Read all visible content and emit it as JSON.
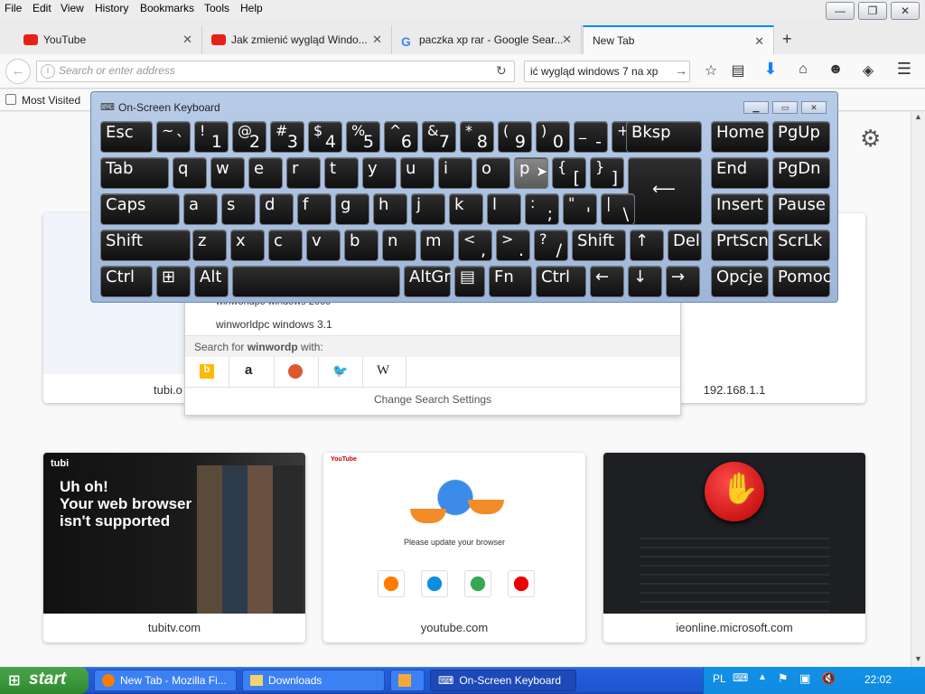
{
  "menubar": {
    "items": [
      "File",
      "Edit",
      "View",
      "History",
      "Bookmarks",
      "Tools",
      "Help"
    ]
  },
  "window_controls": {
    "minimize": "—",
    "maximize": "❐",
    "close": "✕"
  },
  "tabs": [
    {
      "label": "YouTube",
      "icon": "youtube-icon"
    },
    {
      "label": "Jak zmienić wygląd Windo...",
      "icon": "youtube-icon"
    },
    {
      "label": "paczka xp rar - Google Sear...",
      "icon": "google-icon"
    },
    {
      "label": "New Tab",
      "icon": "",
      "active": true
    }
  ],
  "navbar": {
    "url_placeholder": "Search or enter address",
    "search_value": "ić wygląd windows 7 na xp"
  },
  "bookmarks": {
    "most_visited": "Most Visited"
  },
  "dropdown": {
    "suggestions": [
      "winworldpc windows 2000",
      "winworldpc windows 3.1"
    ],
    "search_for_prefix": "Search for ",
    "search_for_term": "winwordp",
    "search_for_suffix": " with:",
    "engines": [
      "bing",
      "amazon",
      "duckduckgo",
      "twitter",
      "wikipedia"
    ],
    "wiki_label": "W",
    "change_settings": "Change Search Settings"
  },
  "top_sites_row1": {
    "left_label": "tubi.o",
    "right_label": "192.168.1.1"
  },
  "top_sites": [
    {
      "label": "tubitv.com",
      "headline": "Uh oh!\nYour web browser\nisn't supported",
      "brand": "tubi"
    },
    {
      "label": "youtube.com",
      "headline": "Please update your browser",
      "brand": "YouTube",
      "browsers": [
        "Mozilla Firefox",
        "Microsoft Edge",
        "Google Chrome",
        "Opera"
      ]
    },
    {
      "label": "ieonline.microsoft.com"
    }
  ],
  "osk": {
    "title": "On-Screen Keyboard",
    "rows": [
      [
        {
          "m": "Esc"
        },
        {
          "t": "~",
          "b": "`"
        },
        {
          "t": "!",
          "b": "1"
        },
        {
          "t": "@",
          "b": "2"
        },
        {
          "t": "#",
          "b": "3"
        },
        {
          "t": "$",
          "b": "4"
        },
        {
          "t": "%",
          "b": "5"
        },
        {
          "t": "^",
          "b": "6"
        },
        {
          "t": "&",
          "b": "7"
        },
        {
          "t": "*",
          "b": "8"
        },
        {
          "t": "(",
          "b": "9"
        },
        {
          "t": ")",
          "b": "0"
        },
        {
          "t": "_",
          "b": "-"
        },
        {
          "t": "+",
          "b": "="
        },
        {
          "m": "Bksp"
        },
        {
          "m": "Home"
        },
        {
          "m": "PgUp"
        }
      ],
      [
        {
          "m": "Tab"
        },
        {
          "m": "q"
        },
        {
          "m": "w"
        },
        {
          "m": "e"
        },
        {
          "m": "r"
        },
        {
          "m": "t"
        },
        {
          "m": "y"
        },
        {
          "m": "u"
        },
        {
          "m": "i"
        },
        {
          "m": "o"
        },
        {
          "m": "p"
        },
        {
          "t": "{",
          "b": "["
        },
        {
          "t": "}",
          "b": "]"
        },
        {
          "m": ""
        },
        {
          "m": "End"
        },
        {
          "m": "PgDn"
        }
      ],
      [
        {
          "m": "Caps"
        },
        {
          "m": "a"
        },
        {
          "m": "s"
        },
        {
          "m": "d"
        },
        {
          "m": "f"
        },
        {
          "m": "g"
        },
        {
          "m": "h"
        },
        {
          "m": "j"
        },
        {
          "m": "k"
        },
        {
          "m": "l"
        },
        {
          "t": ":",
          "b": ";"
        },
        {
          "t": "\"",
          "b": "'"
        },
        {
          "t": "|",
          "b": "\\"
        },
        {
          "m": "Insert"
        },
        {
          "m": "Pause"
        }
      ],
      [
        {
          "m": "Shift"
        },
        {
          "m": "z"
        },
        {
          "m": "x"
        },
        {
          "m": "c"
        },
        {
          "m": "v"
        },
        {
          "m": "b"
        },
        {
          "m": "n"
        },
        {
          "m": "m"
        },
        {
          "t": "<",
          "b": ","
        },
        {
          "t": ">",
          "b": "."
        },
        {
          "t": "?",
          "b": "/"
        },
        {
          "m": "Shift"
        },
        {
          "m": "↑"
        },
        {
          "m": "Del"
        },
        {
          "m": "PrtScn"
        },
        {
          "m": "ScrLk"
        }
      ],
      [
        {
          "m": "Ctrl"
        },
        {
          "m": "⊞"
        },
        {
          "m": "Alt"
        },
        {
          "m": ""
        },
        {
          "m": "AltGr"
        },
        {
          "m": "▤"
        },
        {
          "m": "Fn"
        },
        {
          "m": "Ctrl"
        },
        {
          "m": "←"
        },
        {
          "m": "↓"
        },
        {
          "m": "→"
        },
        {
          "m": "Opcje"
        },
        {
          "m": "Pomoc"
        }
      ]
    ]
  },
  "taskbar": {
    "start": "start",
    "tasks": [
      {
        "label": "New Tab - Mozilla Fi...",
        "icon": "firefox-icon"
      },
      {
        "label": "Downloads",
        "icon": "folder-icon"
      },
      {
        "label": "",
        "icon": "media-icon"
      },
      {
        "label": "On-Screen Keyboard",
        "icon": "keyboard-icon",
        "active": true
      }
    ],
    "lang": "PL",
    "clock": "22:02"
  }
}
